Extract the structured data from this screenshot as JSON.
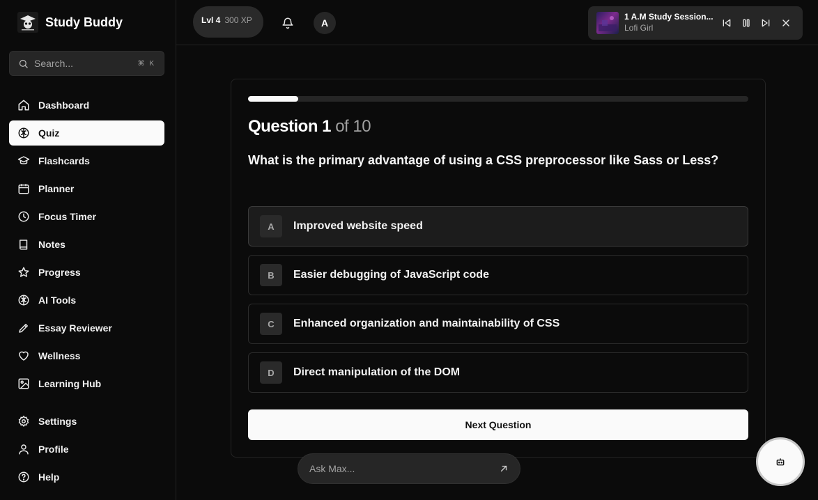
{
  "app": {
    "name": "Study Buddy",
    "logo": "graduate-owl-logo"
  },
  "search": {
    "placeholder": "Search...",
    "shortcut": "⌘ K"
  },
  "sidebar": {
    "items": [
      {
        "label": "Dashboard",
        "icon": "home-icon",
        "active": false
      },
      {
        "label": "Quiz",
        "icon": "brain-icon",
        "active": true
      },
      {
        "label": "Flashcards",
        "icon": "graduation-cap-icon",
        "active": false
      },
      {
        "label": "Planner",
        "icon": "calendar-icon",
        "active": false
      },
      {
        "label": "Focus Timer",
        "icon": "clock-icon",
        "active": false
      },
      {
        "label": "Notes",
        "icon": "book-icon",
        "active": false
      },
      {
        "label": "Progress",
        "icon": "star-icon",
        "active": false
      },
      {
        "label": "AI Tools",
        "icon": "brain-icon",
        "active": false
      },
      {
        "label": "Essay Reviewer",
        "icon": "pen-icon",
        "active": false
      },
      {
        "label": "Wellness",
        "icon": "heart-icon",
        "active": false
      },
      {
        "label": "Learning Hub",
        "icon": "image-icon",
        "active": false
      }
    ],
    "bottom": [
      {
        "label": "Settings",
        "icon": "gear-icon"
      },
      {
        "label": "Profile",
        "icon": "user-icon"
      },
      {
        "label": "Help",
        "icon": "help-circle-icon"
      }
    ]
  },
  "topbar": {
    "level": "Lvl 4",
    "xp": "300 XP",
    "avatar_initial": "A",
    "player": {
      "title": "1 A.M Study Session...",
      "artist": "Lofi Girl"
    }
  },
  "quiz": {
    "progress": 0.1,
    "question_label": "Question 1",
    "of_label": "of 10",
    "question": "What is the primary advantage of using a CSS preprocessor like Sass or Less?",
    "options": [
      {
        "letter": "A",
        "text": "Improved website speed"
      },
      {
        "letter": "B",
        "text": "Easier debugging of JavaScript code"
      },
      {
        "letter": "C",
        "text": "Enhanced organization and maintainability of CSS"
      },
      {
        "letter": "D",
        "text": "Direct manipulation of the DOM"
      }
    ],
    "next_label": "Next Question"
  },
  "assistant": {
    "placeholder": "Ask Max..."
  },
  "colors": {
    "background": "#0b0b0b",
    "accent": "#fafafa",
    "surface": "#262626"
  }
}
